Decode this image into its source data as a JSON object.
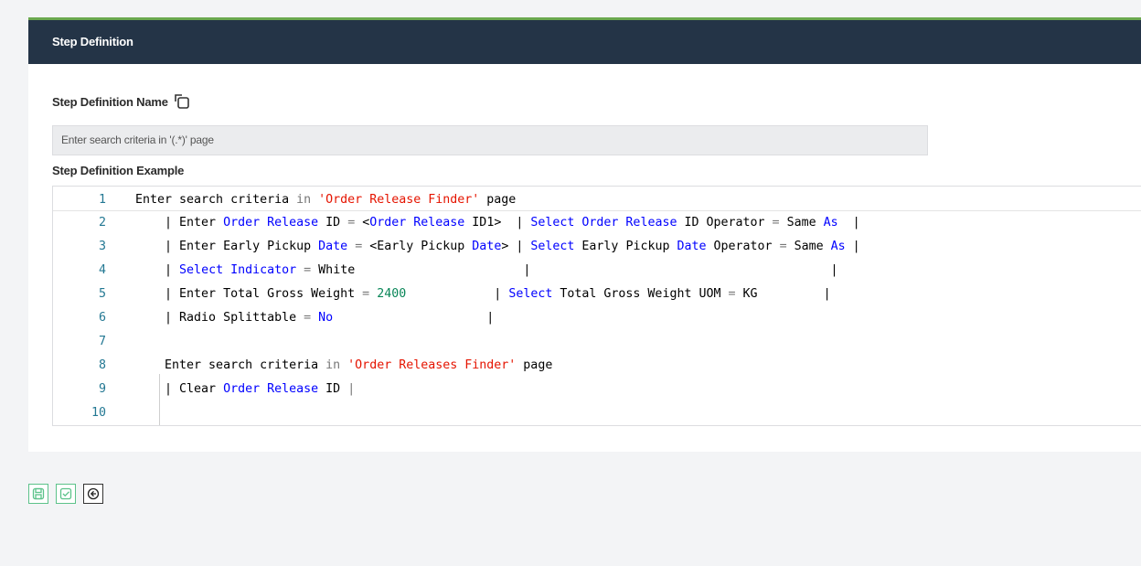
{
  "panel": {
    "title": "Step Definition"
  },
  "step_name": {
    "label": "Step Definition Name",
    "value": "Enter search criteria in '(.*)' page"
  },
  "example": {
    "label": "Step Definition Example",
    "line_numbers": [
      "1",
      "2",
      "3",
      "4",
      "5",
      "6",
      "7",
      "8",
      "9",
      "10"
    ]
  },
  "code_lines": [
    [
      {
        "t": "Enter search criteria ",
        "c": ""
      },
      {
        "t": "in ",
        "c": "dim"
      },
      {
        "t": "'Order Release Finder'",
        "c": "str"
      },
      {
        "t": " page",
        "c": ""
      }
    ],
    [
      {
        "t": "    | Enter ",
        "c": ""
      },
      {
        "t": "Order Release",
        "c": "kw"
      },
      {
        "t": " ID ",
        "c": ""
      },
      {
        "t": "= ",
        "c": "dim"
      },
      {
        "t": "<",
        "c": ""
      },
      {
        "t": "Order Release",
        "c": "kw"
      },
      {
        "t": " ID1>  | ",
        "c": ""
      },
      {
        "t": "Select Order Release",
        "c": "kw"
      },
      {
        "t": " ID Operator ",
        "c": ""
      },
      {
        "t": "=",
        "c": "dim"
      },
      {
        "t": " Same ",
        "c": ""
      },
      {
        "t": "As",
        "c": "kw"
      },
      {
        "t": "  |",
        "c": ""
      }
    ],
    [
      {
        "t": "    | Enter Early Pickup ",
        "c": ""
      },
      {
        "t": "Date",
        "c": "kw"
      },
      {
        "t": " ",
        "c": ""
      },
      {
        "t": "=",
        "c": "dim"
      },
      {
        "t": " <Early Pickup ",
        "c": ""
      },
      {
        "t": "Date",
        "c": "kw"
      },
      {
        "t": "> | ",
        "c": ""
      },
      {
        "t": "Select",
        "c": "kw"
      },
      {
        "t": " Early Pickup ",
        "c": ""
      },
      {
        "t": "Date",
        "c": "kw"
      },
      {
        "t": " Operator ",
        "c": ""
      },
      {
        "t": "=",
        "c": "dim"
      },
      {
        "t": " Same ",
        "c": ""
      },
      {
        "t": "As",
        "c": "kw"
      },
      {
        "t": " |",
        "c": ""
      }
    ],
    [
      {
        "t": "    | ",
        "c": ""
      },
      {
        "t": "Select Indicator",
        "c": "kw"
      },
      {
        "t": " ",
        "c": ""
      },
      {
        "t": "=",
        "c": "dim"
      },
      {
        "t": " White                       |                                         |",
        "c": ""
      }
    ],
    [
      {
        "t": "    | Enter Total Gross Weight ",
        "c": ""
      },
      {
        "t": "=",
        "c": "dim"
      },
      {
        "t": " ",
        "c": ""
      },
      {
        "t": "2400",
        "c": "num"
      },
      {
        "t": "            | ",
        "c": ""
      },
      {
        "t": "Select",
        "c": "kw"
      },
      {
        "t": " Total Gross Weight UOM ",
        "c": ""
      },
      {
        "t": "=",
        "c": "dim"
      },
      {
        "t": " KG         |",
        "c": ""
      }
    ],
    [
      {
        "t": "    | Radio Splittable ",
        "c": ""
      },
      {
        "t": "=",
        "c": "dim"
      },
      {
        "t": " ",
        "c": ""
      },
      {
        "t": "No",
        "c": "kw"
      },
      {
        "t": "                     |",
        "c": ""
      }
    ],
    [
      {
        "t": "",
        "c": ""
      }
    ],
    [
      {
        "t": "    Enter search criteria ",
        "c": ""
      },
      {
        "t": "in ",
        "c": "dim"
      },
      {
        "t": "'Order Releases Finder'",
        "c": "str"
      },
      {
        "t": " page",
        "c": ""
      }
    ],
    [
      {
        "t": "    | Clear ",
        "c": ""
      },
      {
        "t": "Order Release",
        "c": "kw"
      },
      {
        "t": " ID ",
        "c": ""
      },
      {
        "t": "|",
        "c": "dim"
      }
    ],
    [
      {
        "t": "",
        "c": ""
      }
    ]
  ],
  "buttons": {
    "save": "save-icon",
    "validate": "check-square-icon",
    "back": "arrow-left-circle-icon"
  },
  "colors": {
    "header_bg": "#243447",
    "accent_green": "#6aa84f",
    "button_green": "#5cc28a"
  }
}
